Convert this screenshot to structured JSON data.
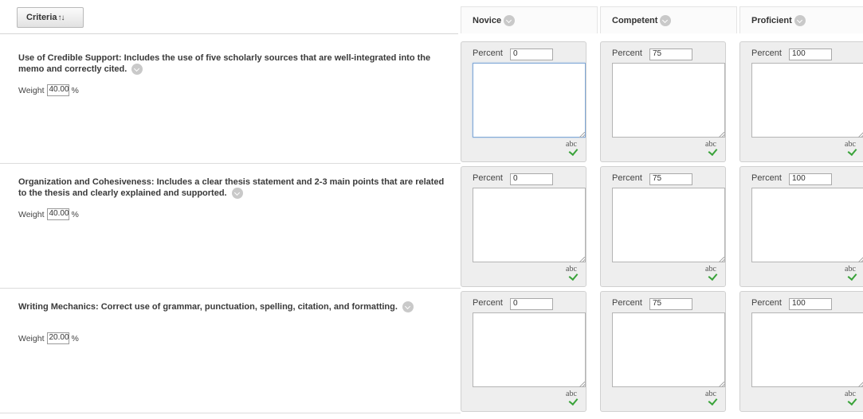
{
  "header": {
    "criteria_button": "Criteria",
    "sort_glyph": "↑↓",
    "levels": [
      "Novice",
      "Competent",
      "Proficient"
    ]
  },
  "labels": {
    "weight": "Weight",
    "weight_unit": "%",
    "percent": "Percent",
    "spellcheck": "abc"
  },
  "rows": [
    {
      "criterion": "Use of Credible Support: Includes the use of five scholarly sources that are well-integrated into the memo and correctly cited.",
      "weight": "40.00",
      "percents": [
        "0",
        "75",
        "100"
      ]
    },
    {
      "criterion": "Organization and Cohesiveness: Includes a clear thesis statement and 2-3 main points that are related to the thesis and clearly explained and supported.",
      "weight": "40.00",
      "percents": [
        "0",
        "75",
        "100"
      ]
    },
    {
      "criterion": "Writing Mechanics: Correct use of grammar, punctuation, spelling, citation, and formatting.",
      "weight": "20.00",
      "percents": [
        "0",
        "75",
        "100"
      ]
    }
  ],
  "colors": {
    "focus_border": "#7fa7d6",
    "check_green": "#3aa33a",
    "cell_bg": "#eeeeee"
  },
  "icons": {
    "sort": "sort-arrows-icon",
    "options": "chevron-down-circle-icon",
    "spellcheck": "spellcheck-icon"
  }
}
